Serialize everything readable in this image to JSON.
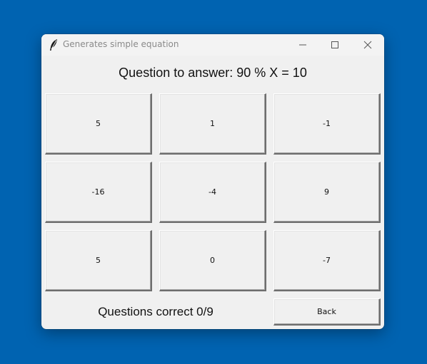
{
  "window": {
    "title": "Generates simple equation",
    "icon": "feather-icon",
    "controls": [
      "minimize-icon",
      "maximize-icon",
      "close-icon"
    ]
  },
  "question": {
    "text": "Question to answer: 90 % X = 10"
  },
  "answers": [
    "5",
    "1",
    "-1",
    "-16",
    "-4",
    "9",
    "5",
    "0",
    "-7"
  ],
  "footer": {
    "score_text": "Questions correct 0/9",
    "back_label": "Back"
  },
  "colors": {
    "desktop": "#0063b1",
    "window_bg": "#f0f0f0",
    "title_text": "#8a8a8a"
  }
}
